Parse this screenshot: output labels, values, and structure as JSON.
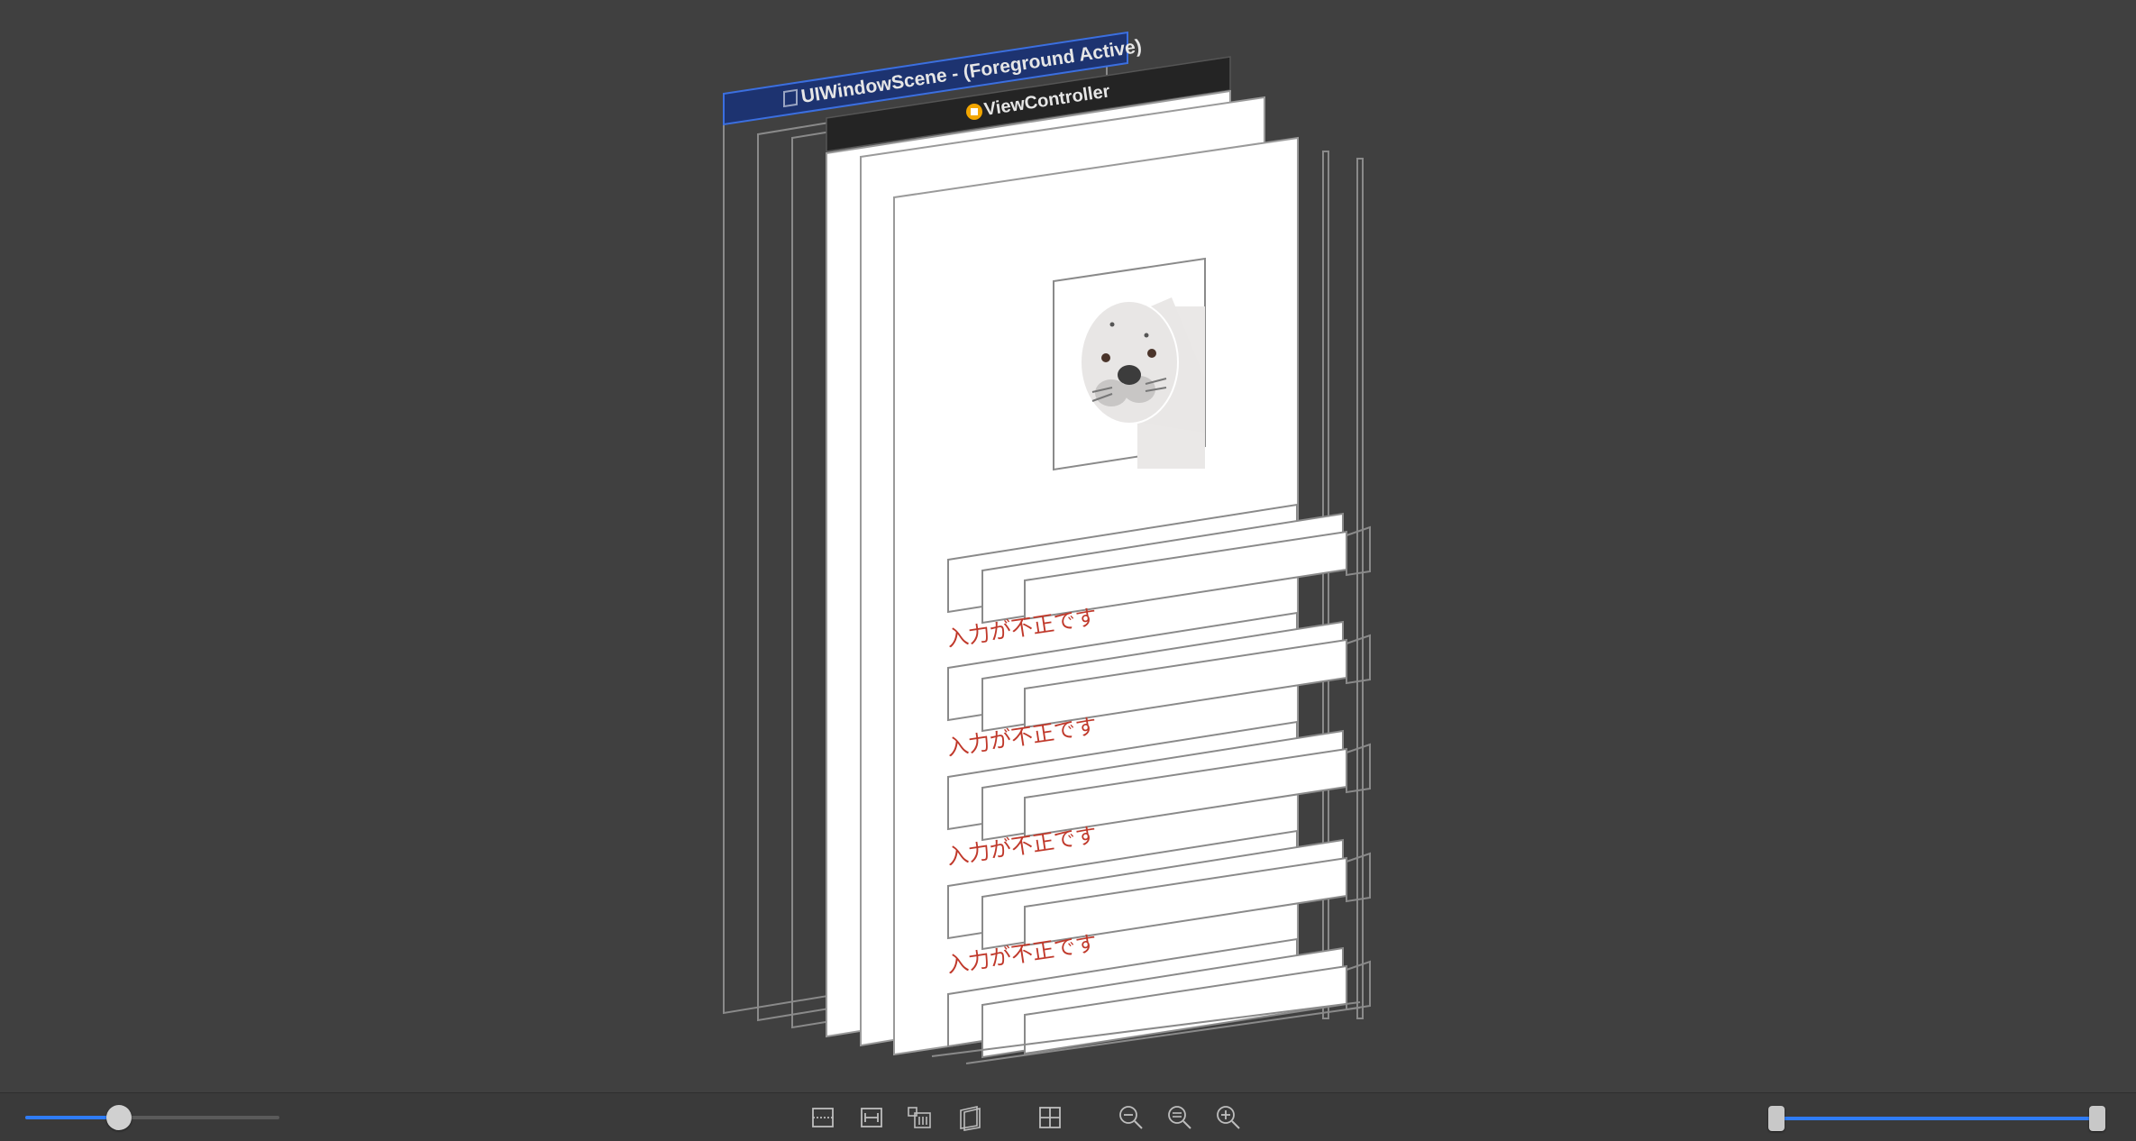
{
  "scene": {
    "window_scene_label": "UIWindowScene - (Foreground Active)",
    "view_controller_label": "ViewController",
    "error_message": "入力が不正です",
    "error_color": "#c0392b",
    "window_scene_color": "#1d3370",
    "view_controller_bar_color": "#242424",
    "selection_color": "#2f7cf6"
  },
  "toolbar": {
    "zoom_level": 0.37,
    "range_lower": 0.0,
    "range_upper": 1.0,
    "buttons": [
      {
        "name": "show-clipped-content-icon"
      },
      {
        "name": "show-constraints-icon"
      },
      {
        "name": "adjust-spacing-icon"
      },
      {
        "name": "change-orientation-icon"
      },
      {
        "name": "orient-to-2d-icon"
      },
      {
        "name": "zoom-out-icon"
      },
      {
        "name": "zoom-actual-size-icon"
      },
      {
        "name": "zoom-in-icon"
      }
    ]
  }
}
